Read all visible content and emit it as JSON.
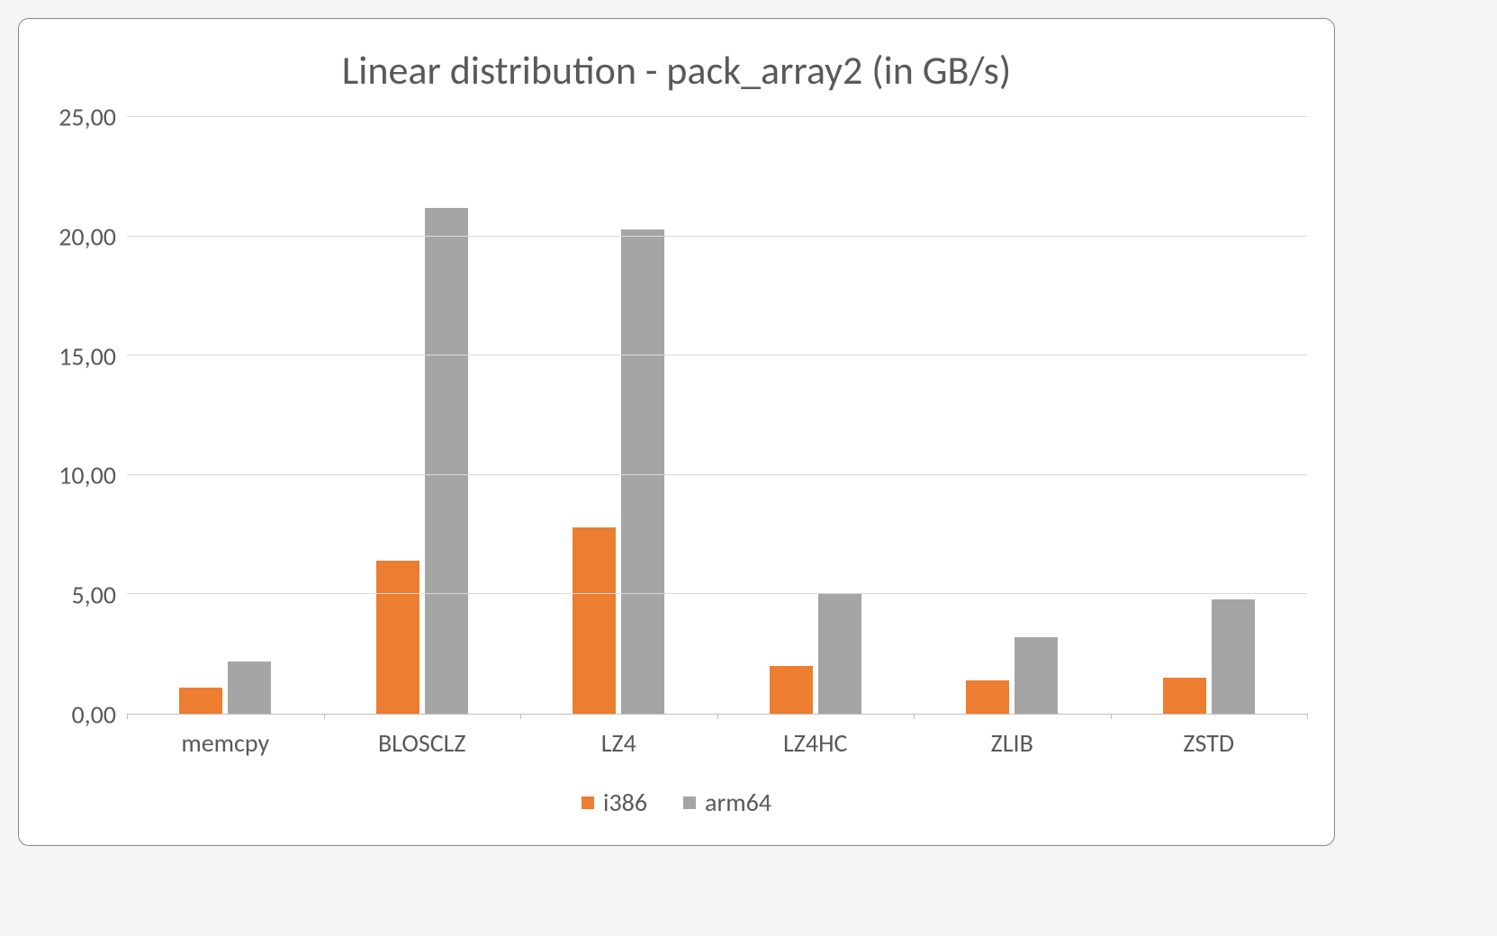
{
  "chart_data": {
    "type": "bar",
    "title": "Linear distribution - pack_array2 (in GB/s)",
    "categories": [
      "memcpy",
      "BLOSCLZ",
      "LZ4",
      "LZ4HC",
      "ZLIB",
      "ZSTD"
    ],
    "series": [
      {
        "name": "i386",
        "color": "#ed7d31",
        "values": [
          1.1,
          6.4,
          7.8,
          2.0,
          1.4,
          1.5
        ]
      },
      {
        "name": "arm64",
        "color": "#a5a5a5",
        "values": [
          2.2,
          21.2,
          20.3,
          5.0,
          3.2,
          4.8
        ]
      }
    ],
    "ylim": [
      0,
      25
    ],
    "y_ticks": [
      0,
      5,
      10,
      15,
      20,
      25
    ],
    "y_tick_labels": [
      "0,00",
      "5,00",
      "10,00",
      "15,00",
      "20,00",
      "25,00"
    ],
    "xlabel": "",
    "ylabel": "",
    "grid": true,
    "legend_position": "bottom"
  }
}
